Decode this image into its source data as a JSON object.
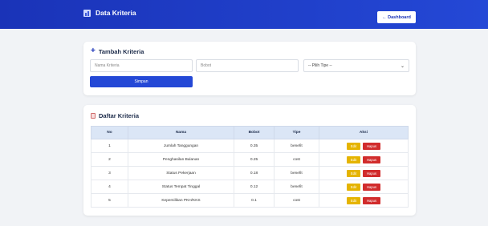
{
  "header": {
    "title": "Data Kriteria",
    "dashboard_button": "← Dashboard",
    "accent": "#2448d6"
  },
  "form": {
    "title": "Tambah Kriteria",
    "nama_placeholder": "Nama Kriteria",
    "bobot_placeholder": "Bobot",
    "tipe_selected": "-- Pilih Tipe --",
    "submit_label": "Simpan"
  },
  "list": {
    "title": "Daftar Kriteria",
    "columns": [
      "No",
      "Nama",
      "Bobot",
      "Tipe",
      "Aksi"
    ],
    "rows": [
      {
        "no": "1",
        "nama": "Jumlah Tanggungan",
        "bobot": "0.35",
        "tipe": "benefit"
      },
      {
        "no": "2",
        "nama": "Penghasilan Bulanan",
        "bobot": "0.25",
        "tipe": "cost"
      },
      {
        "no": "3",
        "nama": "Status Pekerjaan",
        "bobot": "0.18",
        "tipe": "benefit"
      },
      {
        "no": "4",
        "nama": "Status Tempat Tinggal",
        "bobot": "0.12",
        "tipe": "benefit"
      },
      {
        "no": "5",
        "nama": "Kepemilikan PKH/KKS",
        "bobot": "0.1",
        "tipe": "cost"
      }
    ],
    "edit_label": "Edit",
    "hapus_label": "Hapus",
    "colors": {
      "edit": "#e5b400",
      "hapus": "#d12c2c",
      "header_bg": "#dbe6f6"
    }
  }
}
